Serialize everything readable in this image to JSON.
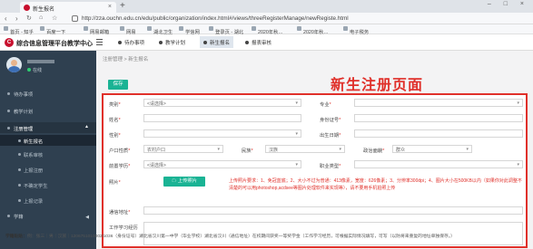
{
  "browser": {
    "tab_title": "新生报名",
    "url": "http://zza.ouchn.edu.cn/edu/public/organization/index.html#/views/threeRegisterManage/newRegiste.html",
    "bookmarks": [
      "首页 - 知乎",
      "百度一下",
      "网易邮箱",
      "网易",
      "湖北卫生",
      "学信网",
      "登录页 - 湖北",
      "2020年秋…",
      "2020年秋…",
      "电子税务"
    ]
  },
  "app": {
    "title": "综合信息管理平台教学中心",
    "menus": [
      "待办事项",
      "教学计划",
      "新生报名",
      "报表审核"
    ],
    "active_menu_index": 2
  },
  "user": {
    "status": "在线"
  },
  "sidebar": {
    "items": [
      "待办事项",
      "教学计划",
      "注册管理"
    ],
    "subitems": [
      "新生报名",
      "联系审核",
      "上报注册",
      "不确定学生",
      "上报记录"
    ],
    "last_item": "学籍"
  },
  "main": {
    "breadcrumb": "注册管理 > 新生报名",
    "save_label": "保存",
    "annotation": "新生注册页面"
  },
  "form": {
    "type_label": "类别",
    "type_value": "<请选择>",
    "major_label": "专业",
    "name_label": "姓名",
    "id_label": "身份证号",
    "gender_label": "性别",
    "birthday_label": "出生日期",
    "hukou_label": "户口性质",
    "hukou_value": "农村户口",
    "ethnicity_label": "民族",
    "ethnicity_value": "汉族",
    "politics_label": "政治面貌",
    "politics_value": "群众",
    "edu_label": "前置学历",
    "edu_value": "<请选择>",
    "job_label": "职业类型",
    "photo_label": "照片",
    "upload_label": "上传照片",
    "upload_tip": "上传照片要求：1、免冠蓝底；2、大小不过为普通：413像素，宽度：626像素；3、分辨率300dpi；4、图片大小在500KB以内（如果你对此调整不清楚的可以用photoshop,acdsee等图片处理软件来实现等），请不要用手机拍照上传",
    "address_label": "通信地址",
    "history_label": "工作学习经历"
  },
  "footer": {
    "label": "学籍贴贴：",
    "text": "例：张三｜男｜汉族｜1206751010002l1036（身份证号）湖北省汉川第一中学（毕业学校）湖北省汉川（通信地址）在校期间获奖一等奖学金（工作学习经历，可根据实际情况填写，可写（以防将来重复的地址单独保存。）"
  }
}
